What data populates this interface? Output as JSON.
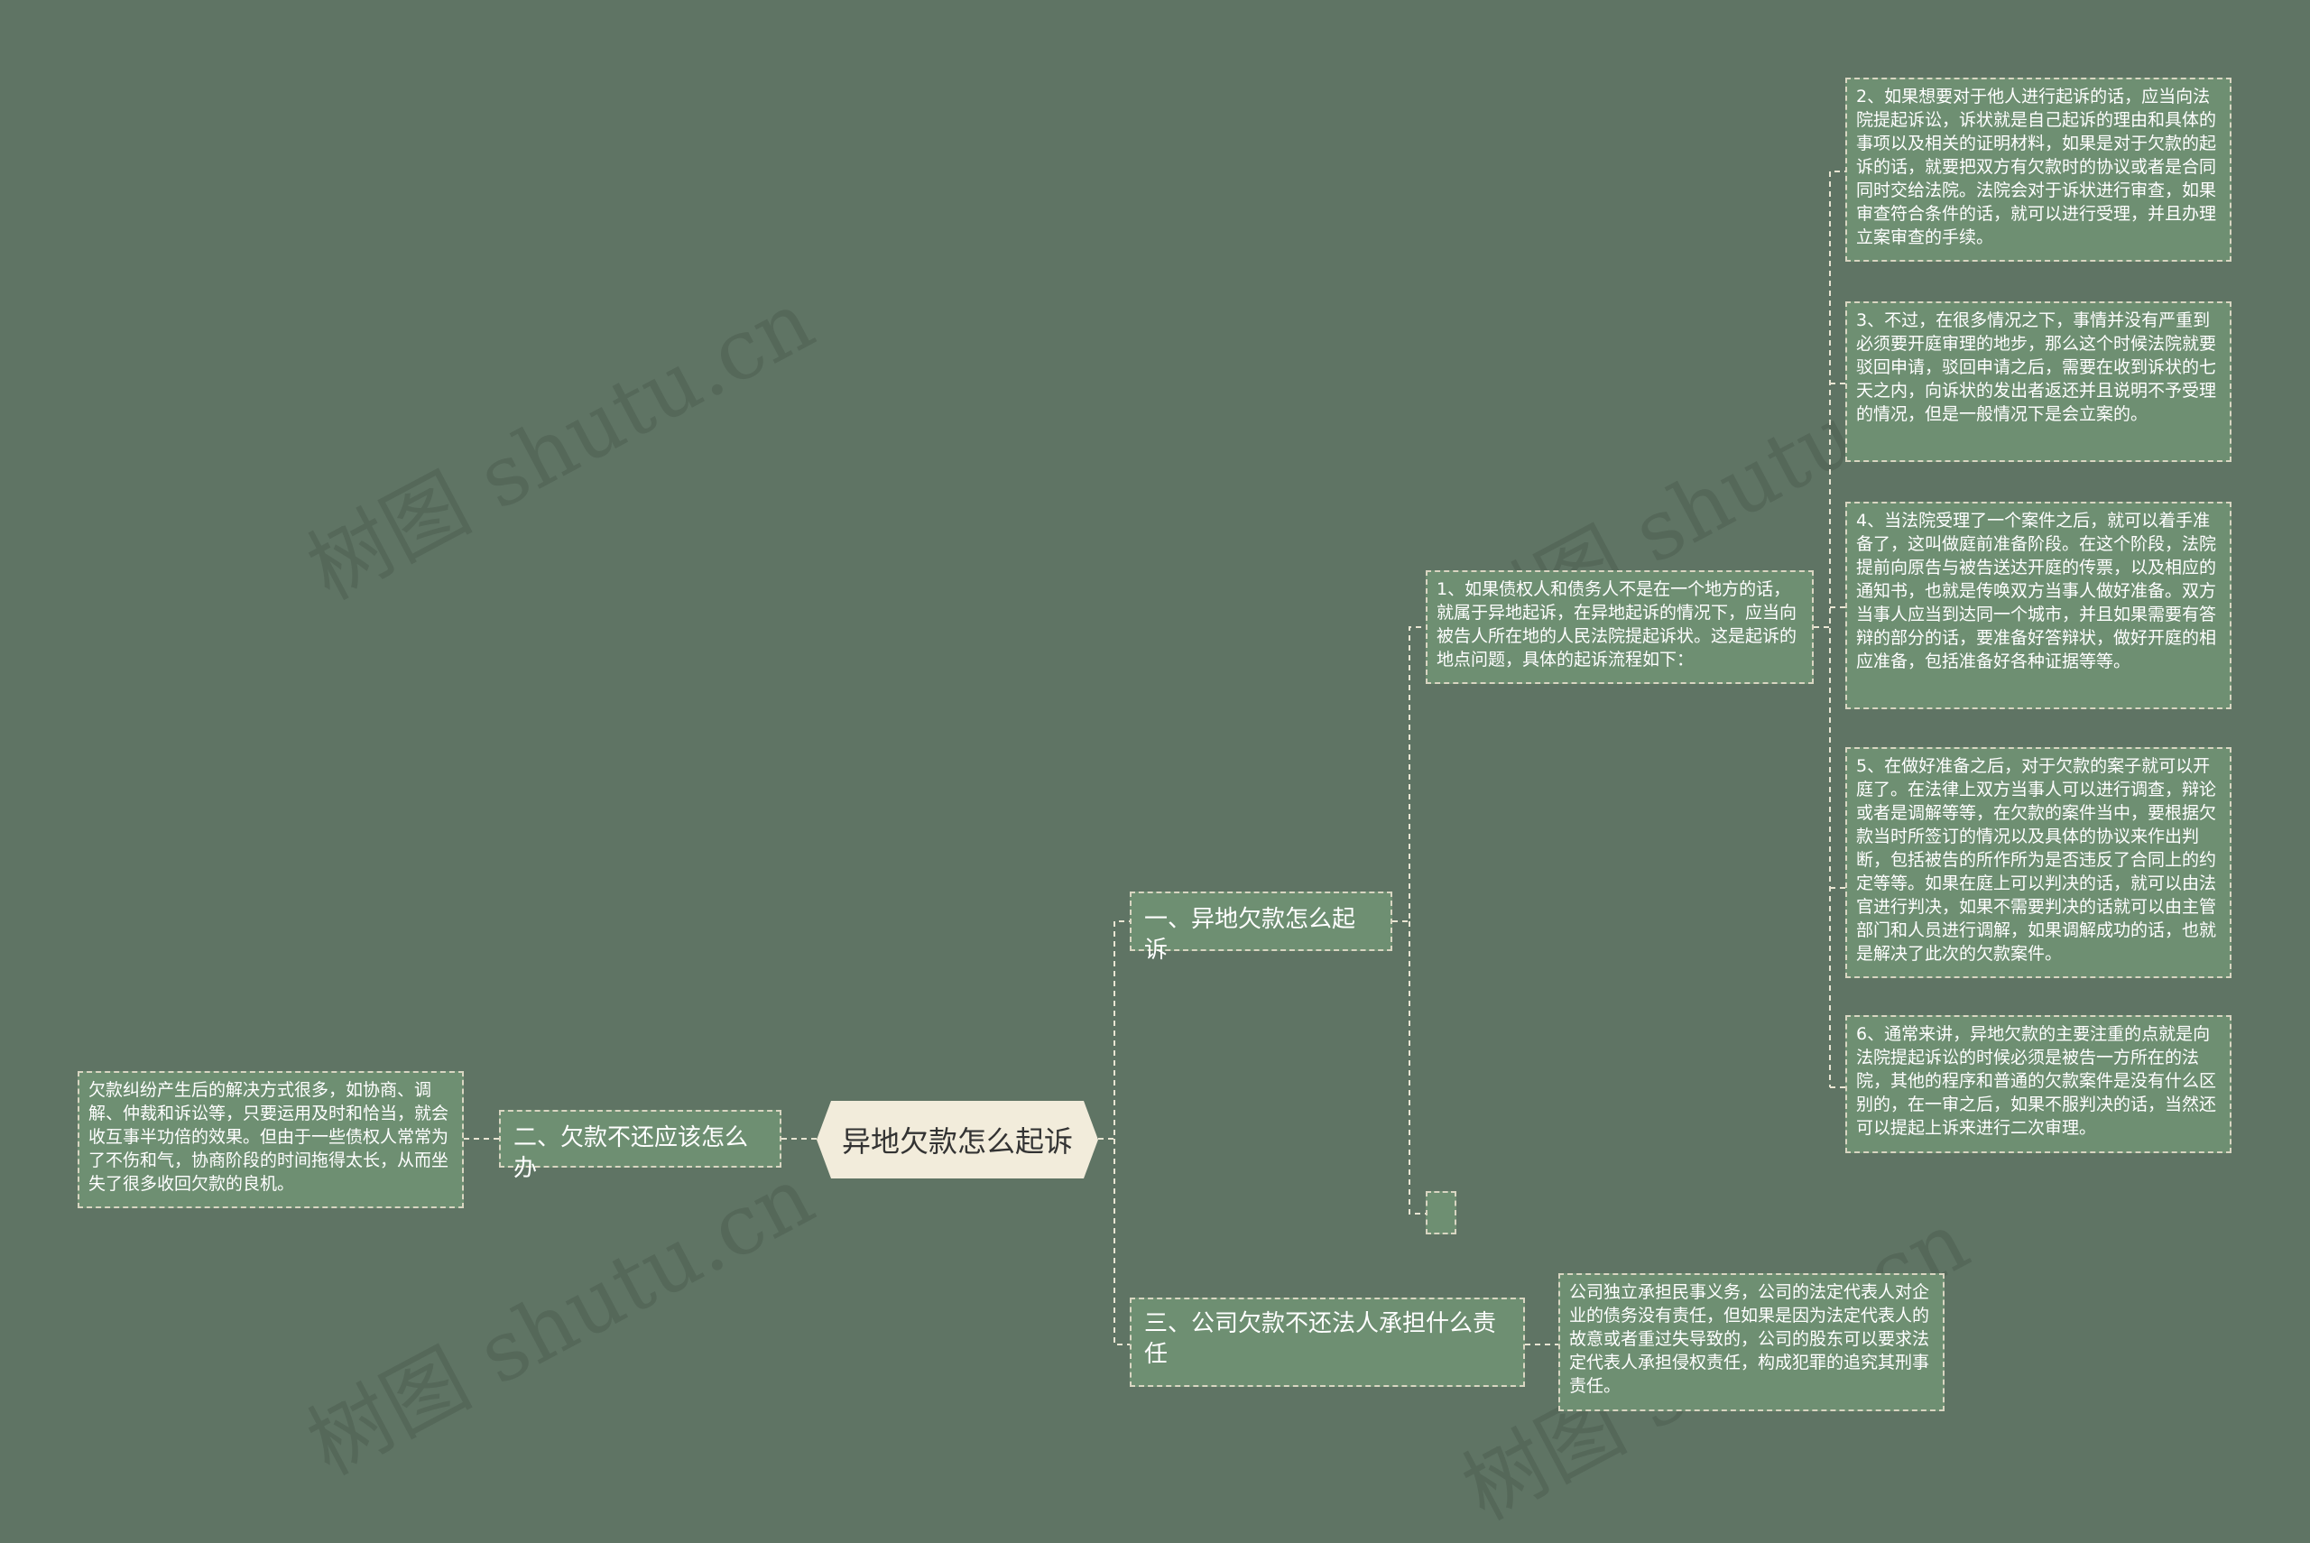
{
  "root": {
    "label": "异地欠款怎么起诉"
  },
  "branches": {
    "b1": {
      "label": "一、异地欠款怎么起诉"
    },
    "b2": {
      "label": "二、欠款不还应该怎么办"
    },
    "b3": {
      "label": "三、公司欠款不还法人承担什么责任"
    }
  },
  "b1_child": "1、如果债权人和债务人不是在一个地方的话，就属于异地起诉，在异地起诉的情况下，应当向被告人所在地的人民法院提起诉状。这是起诉的地点问题，具体的起诉流程如下：",
  "steps": [
    "2、如果想要对于他人进行起诉的话，应当向法院提起诉讼，诉状就是自己起诉的理由和具体的事项以及相关的证明材料，如果是对于欠款的起诉的话，就要把双方有欠款时的协议或者是合同同时交给法院。法院会对于诉状进行审查，如果审查符合条件的话，就可以进行受理，并且办理立案审查的手续。",
    "3、不过，在很多情况之下，事情并没有严重到必须要开庭审理的地步，那么这个时候法院就要驳回申请，驳回申请之后，需要在收到诉状的七天之内，向诉状的发出者返还并且说明不予受理的情况，但是一般情况下是会立案的。",
    "4、当法院受理了一个案件之后，就可以着手准备了，这叫做庭前准备阶段。在这个阶段，法院提前向原告与被告送达开庭的传票，以及相应的通知书，也就是传唤双方当事人做好准备。双方当事人应当到达同一个城市，并且如果需要有答辩的部分的话，要准备好答辩状，做好开庭的相应准备，包括准备好各种证据等等。",
    "5、在做好准备之后，对于欠款的案子就可以开庭了。在法律上双方当事人可以进行调查，辩论或者是调解等等，在欠款的案件当中，要根据欠款当时所签订的情况以及具体的协议来作出判断，包括被告的所作所为是否违反了合同上的约定等等。如果在庭上可以判决的话，就可以由法官进行判决，如果不需要判决的话就可以由主管部门和人员进行调解，如果调解成功的话，也就是解决了此次的欠款案件。",
    "6、通常来讲，异地欠款的主要注重的点就是向法院提起诉讼的时候必须是被告一方所在的法院，其他的程序和普通的欠款案件是没有什么区别的，在一审之后，如果不服判决的话，当然还可以提起上诉来进行二次审理。"
  ],
  "b2_child": "欠款纠纷产生后的解决方式很多，如协商、调解、仲裁和诉讼等，只要运用及时和恰当，就会收互事半功倍的效果。但由于一些债权人常常为了不伤和气，协商阶段的时间拖得太长，从而坐失了很多收回欠款的良机。",
  "b3_child": "公司独立承担民事义务，公司的法定代表人对企业的债务没有责任，但如果是因为法定代表人的故意或者重过失导致的，公司的股东可以要求法定代表人承担侵权责任，构成犯罪的追究其刑事责任。",
  "watermark": "树图 shutu.cn"
}
